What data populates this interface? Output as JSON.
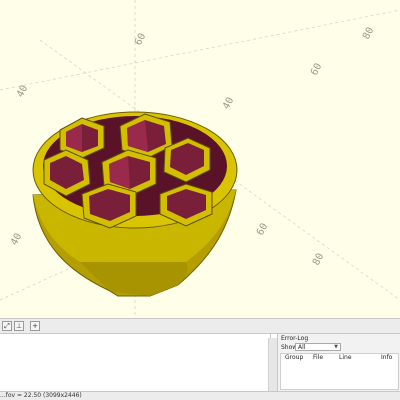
{
  "viewport": {
    "axis_labels": [
      "40",
      "60",
      "40",
      "60",
      "80",
      "40",
      "60",
      "80"
    ]
  },
  "toolbar": {
    "buttons": [
      {
        "icon": "view-all-icon"
      },
      {
        "icon": "axes-icon"
      },
      {
        "icon": "crosshairs-icon"
      }
    ]
  },
  "error_log": {
    "title": "Error-Log",
    "show_label": "Show",
    "show_value": "All",
    "columns": [
      "Group",
      "File",
      "Line",
      "Info"
    ]
  },
  "status_bar": {
    "text": "...fov = 22.50 (3099x2446)"
  },
  "colors": {
    "viewport_bg": "#fffee8",
    "model_outer": "#c9b800",
    "model_inner": "#7a1f3a"
  }
}
